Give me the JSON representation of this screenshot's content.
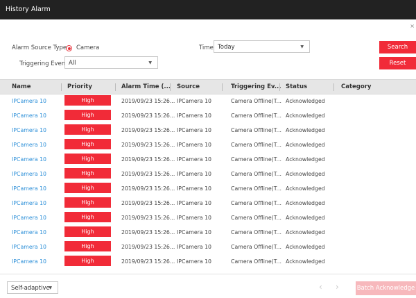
{
  "window": {
    "title": "History Alarm",
    "close": "×"
  },
  "filters": {
    "alarm_source_type_label": "Alarm Source Type",
    "source_option": "Camera",
    "time_label": "Time",
    "time_value": "Today",
    "triggering_event_label": "Triggering Event",
    "triggering_event_value": "All",
    "search_label": "Search",
    "reset_label": "Reset"
  },
  "table": {
    "headers": [
      "Name",
      "Priority",
      "Alarm Time (...",
      "Source",
      "Triggering Ev...",
      "Status",
      "Category"
    ],
    "rows": [
      {
        "name": "IPCamera 10",
        "priority": "High",
        "time": "2019/09/23 15:26...",
        "source": "IPCamera 10",
        "event": "Camera Offline(T...",
        "status": "Acknowledged",
        "category": ""
      },
      {
        "name": "IPCamera 10",
        "priority": "High",
        "time": "2019/09/23 15:26...",
        "source": "IPCamera 10",
        "event": "Camera Offline(T...",
        "status": "Acknowledged",
        "category": ""
      },
      {
        "name": "IPCamera 10",
        "priority": "High",
        "time": "2019/09/23 15:26...",
        "source": "IPCamera 10",
        "event": "Camera Offline(T...",
        "status": "Acknowledged",
        "category": ""
      },
      {
        "name": "IPCamera 10",
        "priority": "High",
        "time": "2019/09/23 15:26...",
        "source": "IPCamera 10",
        "event": "Camera Offline(T...",
        "status": "Acknowledged",
        "category": ""
      },
      {
        "name": "IPCamera 10",
        "priority": "High",
        "time": "2019/09/23 15:26...",
        "source": "IPCamera 10",
        "event": "Camera Offline(T...",
        "status": "Acknowledged",
        "category": ""
      },
      {
        "name": "IPCamera 10",
        "priority": "High",
        "time": "2019/09/23 15:26...",
        "source": "IPCamera 10",
        "event": "Camera Offline(T...",
        "status": "Acknowledged",
        "category": ""
      },
      {
        "name": "IPCamera 10",
        "priority": "High",
        "time": "2019/09/23 15:26...",
        "source": "IPCamera 10",
        "event": "Camera Offline(T...",
        "status": "Acknowledged",
        "category": ""
      },
      {
        "name": "IPCamera 10",
        "priority": "High",
        "time": "2019/09/23 15:26...",
        "source": "IPCamera 10",
        "event": "Camera Offline(T...",
        "status": "Acknowledged",
        "category": ""
      },
      {
        "name": "IPCamera 10",
        "priority": "High",
        "time": "2019/09/23 15:26...",
        "source": "IPCamera 10",
        "event": "Camera Offline(T...",
        "status": "Acknowledged",
        "category": ""
      },
      {
        "name": "IPCamera 10",
        "priority": "High",
        "time": "2019/09/23 15:26...",
        "source": "IPCamera 10",
        "event": "Camera Offline(T...",
        "status": "Acknowledged",
        "category": ""
      },
      {
        "name": "IPCamera 10",
        "priority": "High",
        "time": "2019/09/23 15:26...",
        "source": "IPCamera 10",
        "event": "Camera Offline(T...",
        "status": "Acknowledged",
        "category": ""
      },
      {
        "name": "IPCamera 10",
        "priority": "High",
        "time": "2019/09/23 15:26...",
        "source": "IPCamera 10",
        "event": "Camera Offline(T...",
        "status": "Acknowledged",
        "category": ""
      }
    ]
  },
  "footer": {
    "page_size_value": "Self-adaptive",
    "prev": "‹",
    "next": "›",
    "batch_acknowledge_label": "Batch Acknowledge"
  },
  "colors": {
    "accent": "#f12b38",
    "link": "#2c8fd8",
    "titlebar": "#222222",
    "disabled_accent": "#f7b8bc"
  },
  "icons": {
    "caret": "chevron-down-icon",
    "close": "close-icon",
    "prev": "chevron-left-icon",
    "next": "chevron-right-icon"
  }
}
